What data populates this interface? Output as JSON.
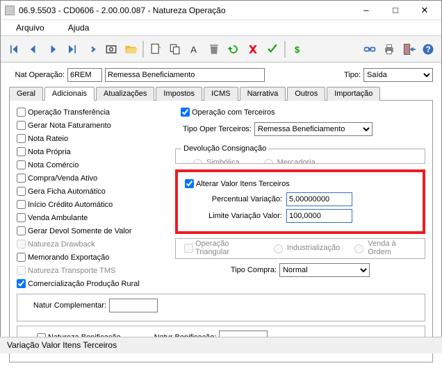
{
  "window": {
    "title": "06.9.5503 - CD0606 - 2.00.00.087 - Natureza Operação"
  },
  "menu": {
    "file": "Arquivo",
    "help": "Ajuda"
  },
  "toolbar": {
    "dollar_color": "#13a10e",
    "undo_color": "#13a10e",
    "cancel_color": "#e81123",
    "confirm_color": "#13a10e"
  },
  "header": {
    "nat_label": "Nat Operação:",
    "nat_code": "6REM",
    "nat_desc": "Remessa Beneficiamento",
    "tipo_label": "Tipo:",
    "tipo_value": "Saída"
  },
  "tabs": {
    "t0": "Geral",
    "t1": "Adicionais",
    "t2": "Atualizações",
    "t3": "Impostos",
    "t4": "ICMS",
    "t5": "Narrativa",
    "t6": "Outros",
    "t7": "Importação"
  },
  "left": {
    "c0": "Operação Transferência",
    "c1": "Gerar Nota Faturamento",
    "c2": "Nota Rateio",
    "c3": "Nota Própria",
    "c4": "Nota Comércio",
    "c5": "Compra/Venda Ativo",
    "c6": "Gera Ficha Automático",
    "c7": "Início Crédito Automático",
    "c8": "Venda Ambulante",
    "c9": "Gerar Devol Somente de Valor",
    "c10": "Natureza Drawback",
    "c11": "Memorando Exportação",
    "c12": "Natureza Transporte TMS",
    "c13": "Comercialização Produção Rural"
  },
  "right": {
    "op_terceiros": "Operação com Terceiros",
    "tipo_oper_label": "Tipo Oper Terceiros:",
    "tipo_oper_value": "Remessa Beneficiamento",
    "devolucao_legend": "Devolução Consignação",
    "r_simbolica": "Simbólica",
    "r_mercadoria": "Mercadoria",
    "alterar_chk": "Alterar Valor Itens Terceiros",
    "perc_label": "Percentual Variação:",
    "perc_value": "5,00000000",
    "lim_label": "Limite Variação Valor:",
    "lim_value": "100,0000",
    "op_triang_legend": "Operação Triangular",
    "r_industr": "Industrialização",
    "r_venda": "Venda à Ordem",
    "tipo_compra_label": "Tipo Compra:",
    "tipo_compra_value": "Normal"
  },
  "bottom": {
    "nat_compl_label": "Natur Complementar:",
    "nat_compl_value": "",
    "nat_bonif_chk": "Natureza Bonificação",
    "nat_bonif_label": "Natur Bonificação:",
    "nat_bonif_value": ""
  },
  "status": {
    "text": "Variação Valor Itens Terceiros"
  }
}
